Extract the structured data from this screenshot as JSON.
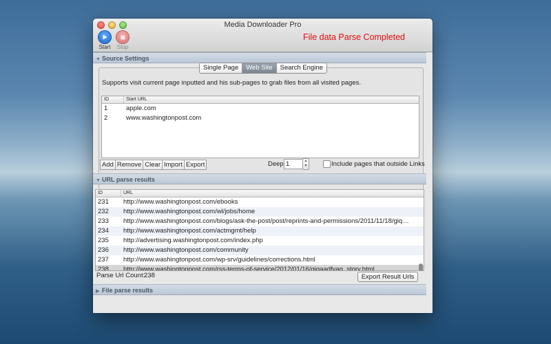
{
  "window": {
    "title": "Media Downloader Pro"
  },
  "toolbar": {
    "start_label": "Start",
    "stop_label": "Stop",
    "status": "File data Parse Completed"
  },
  "source_settings": {
    "header": "Source Settings",
    "tabs": [
      "Single Page",
      "Web Site",
      "Search Engine"
    ],
    "selected_tab": "Web Site",
    "description": "Supports visit current page inputted and his sub-pages to grab files from all visited pages.",
    "columns": [
      "ID",
      "Start URL"
    ],
    "rows": [
      {
        "id": "1",
        "url": "apple.com"
      },
      {
        "id": "2",
        "url": "www.washingtonpost.com"
      }
    ],
    "buttons": [
      "Add",
      "Remove",
      "Clear",
      "Import",
      "Export"
    ],
    "deep_label": "Deep:",
    "deep_value": "1",
    "include_outside_label": "Include pages that outside Links",
    "include_outside_checked": false
  },
  "url_results": {
    "header": "URL parse results",
    "columns": [
      "ID",
      "URL"
    ],
    "rows": [
      {
        "id": "231",
        "url": "http://www.washingtonpost.com/ebooks"
      },
      {
        "id": "232",
        "url": "http://www.washingtonpost.com/wl/jobs/home"
      },
      {
        "id": "233",
        "url": "http://www.washingtonpost.com/blogs/ask-the-post/post/reprints-and-permissions/2011/11/18/giq…"
      },
      {
        "id": "234",
        "url": "http://www.washingtonpost.com/actmgmt/help"
      },
      {
        "id": "235",
        "url": "http://advertising.washingtonpost.com/index.php"
      },
      {
        "id": "236",
        "url": "http://www.washingtonpost.com/community"
      },
      {
        "id": "237",
        "url": "http://www.washingtonpost.com/wp-srv/guidelines/corrections.html"
      },
      {
        "id": "238",
        "url": "http://www.washingtonpost.com/rss-terms-of-service/2012/01/16/giqaadfyaq_story.html"
      }
    ],
    "selected_row": "238",
    "count_label": "Parse Url Count:",
    "count_value": "238",
    "export_label": "Export Result Urls"
  },
  "file_results": {
    "header": "File parse results"
  },
  "colors": {
    "status": "#e01010",
    "section_header": "#c8d2de",
    "selected_row": "#d6d6d6"
  }
}
